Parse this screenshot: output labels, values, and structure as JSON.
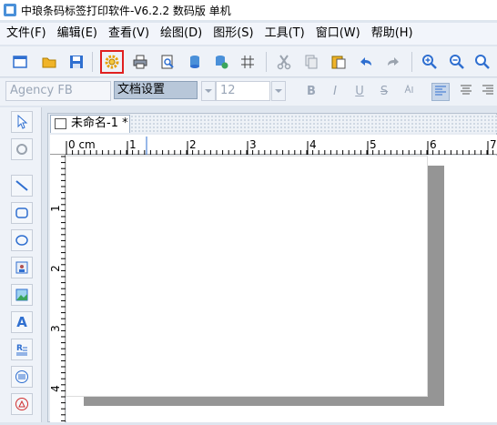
{
  "app": {
    "title": "中琅条码标签打印软件-V6.2.2 数码版 单机"
  },
  "menu": [
    "文件(F)",
    "编辑(E)",
    "查看(V)",
    "绘图(D)",
    "图形(S)",
    "工具(T)",
    "窗口(W)",
    "帮助(H)"
  ],
  "tooltip": "文档设置",
  "format": {
    "font": "Agency FB",
    "size": "12",
    "bold": "B",
    "italic": "I",
    "underline": "U",
    "strike": "S"
  },
  "tab": {
    "name": "未命名-1 *"
  },
  "ruler": {
    "h": [
      "0 cm",
      "1",
      "2",
      "3",
      "4",
      "5",
      "6",
      "7"
    ],
    "v": [
      "1",
      "2",
      "3",
      "4"
    ]
  },
  "tools_text": {
    "text_tool": "A"
  },
  "colors": {
    "highlight": "#e02020",
    "accent": "#2f6fd0"
  }
}
